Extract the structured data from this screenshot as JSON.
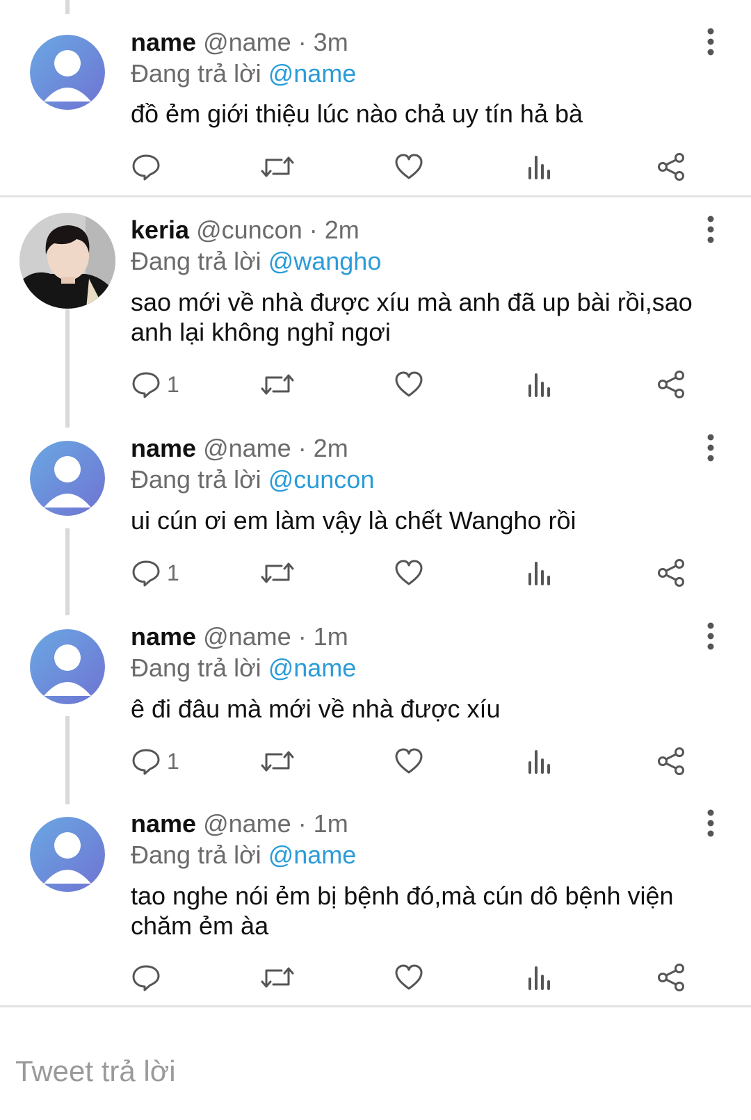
{
  "tweets": [
    {
      "author": "name",
      "handle": "@name",
      "time": "· 3m",
      "reply_prefix": "Đang trả lời",
      "reply_to": "@name",
      "text": "đồ ẻm giới thiệu lúc nào chả uy tín hả bà",
      "reply_count": "",
      "avatar": "default-avatar"
    },
    {
      "author": "keria",
      "handle": "@cuncon",
      "time": "· 2m",
      "reply_prefix": "Đang trả lời",
      "reply_to": "@wangho",
      "text": "sao mới về nhà được xíu mà anh đã up bài rồi,sao anh lại không nghỉ ngơi",
      "reply_count": "1",
      "avatar": "photo-avatar"
    },
    {
      "author": "name",
      "handle": "@name",
      "time": "· 2m",
      "reply_prefix": "Đang trả lời",
      "reply_to": "@cuncon",
      "text": "ui cún ơi em làm vậy là chết Wangho rồi",
      "reply_count": "1",
      "avatar": "default-avatar"
    },
    {
      "author": "name",
      "handle": "@name",
      "time": "· 1m",
      "reply_prefix": "Đang trả lời",
      "reply_to": "@name",
      "text": "ê đi đâu mà mới về nhà được xíu",
      "reply_count": "1",
      "avatar": "default-avatar"
    },
    {
      "author": "name",
      "handle": "@name",
      "time": "· 1m",
      "reply_prefix": "Đang trả lời",
      "reply_to": "@name",
      "text": "tao nghe nói ẻm bị bệnh đó,mà cún dô bệnh viện chăm ẻm àa",
      "reply_count": "",
      "avatar": "default-avatar"
    }
  ],
  "composer": {
    "placeholder": "Tweet trả lời"
  },
  "colors": {
    "mention": "#2a9cd8",
    "muted": "#6b6b6b",
    "avatar_gradient_start": "#6aa8e3",
    "avatar_gradient_end": "#6f73d2"
  },
  "icons": [
    "reply-icon",
    "retweet-icon",
    "like-icon",
    "analytics-icon",
    "share-icon",
    "more-icon"
  ]
}
